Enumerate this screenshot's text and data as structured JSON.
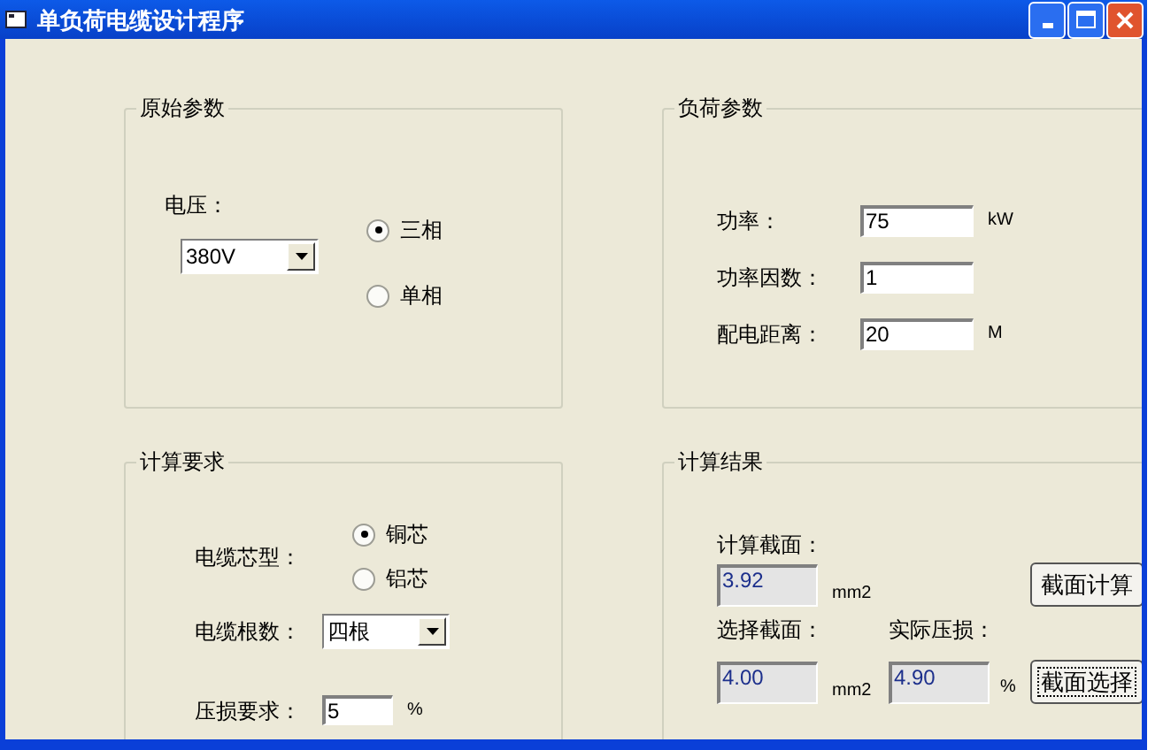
{
  "window": {
    "title": "单负荷电缆设计程序"
  },
  "original_params": {
    "title": "原始参数",
    "voltage_label": "电压：",
    "voltage_value": "380V",
    "phases": [
      {
        "label": "三相",
        "selected": true
      },
      {
        "label": "单相",
        "selected": false
      }
    ]
  },
  "load_params": {
    "title": "负荷参数",
    "fields": [
      {
        "label": "功率：",
        "value": "75",
        "unit": "kW"
      },
      {
        "label": "功率因数：",
        "value": "1"
      },
      {
        "label": "配电距离：",
        "value": "20",
        "unit": "M"
      }
    ]
  },
  "calc_requirements": {
    "title": "计算要求",
    "core_label": "电缆芯型：",
    "cores": [
      {
        "label": "铜芯",
        "selected": true
      },
      {
        "label": "铝芯",
        "selected": false
      }
    ],
    "count_label": "电缆根数：",
    "count_value": "四根",
    "drop_label": "压损要求：",
    "drop_value": "5",
    "drop_unit": "%"
  },
  "results": {
    "title": "计算结果",
    "section_label": "计算截面：",
    "section_value": "3.92",
    "section_unit": "mm2",
    "calc_button": {
      "label": "截面计算",
      "focused": false
    },
    "chosen_label": "选择截面：",
    "chosen_value": "4.00",
    "chosen_unit": "mm2",
    "drop_label": "实际压损：",
    "drop_value": "4.90",
    "drop_unit": "%",
    "select_button": {
      "label": "截面选择",
      "focused": true
    }
  }
}
